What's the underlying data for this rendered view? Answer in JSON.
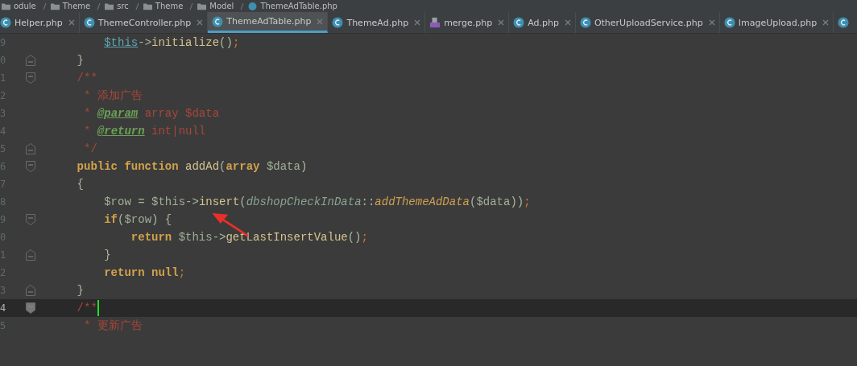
{
  "breadcrumb": [
    {
      "label": "odule",
      "kind": "folder"
    },
    {
      "label": "Theme",
      "kind": "folder"
    },
    {
      "label": "src",
      "kind": "folder"
    },
    {
      "label": "Theme",
      "kind": "folder"
    },
    {
      "label": "Model",
      "kind": "folder"
    },
    {
      "label": "ThemeAdTable.php",
      "kind": "class"
    }
  ],
  "tabs": [
    {
      "label": "Helper.php",
      "kind": "class",
      "selected": false
    },
    {
      "label": "ThemeController.php",
      "kind": "class",
      "selected": false
    },
    {
      "label": "ThemeAdTable.php",
      "kind": "class",
      "selected": true
    },
    {
      "label": "ThemeAd.php",
      "kind": "class",
      "selected": false
    },
    {
      "label": "merge.php",
      "kind": "php",
      "selected": false
    },
    {
      "label": "Ad.php",
      "kind": "class",
      "selected": false
    },
    {
      "label": "OtherUploadService.php",
      "kind": "class",
      "selected": false
    },
    {
      "label": "ImageUpload.php",
      "kind": "class",
      "selected": false
    },
    {
      "kind": "class",
      "selected": false
    }
  ],
  "lines": [
    {
      "number": "9",
      "current": false,
      "tokens": [
        {
          "text": "        $this",
          "kind": "thisref"
        },
        {
          "text": "->",
          "kind": "plain"
        },
        {
          "text": "initialize",
          "kind": "method"
        },
        {
          "text": "()",
          "kind": "plain"
        },
        {
          "text": ";",
          "kind": "punct"
        }
      ]
    },
    {
      "number": "0",
      "current": false,
      "fold": {
        "kind": "end"
      },
      "tokens": [
        {
          "text": "    }",
          "kind": "plain"
        }
      ]
    },
    {
      "number": "1",
      "current": false,
      "fold": {
        "kind": "start"
      },
      "tokens": [
        {
          "text": "    /**",
          "kind": "comment"
        }
      ]
    },
    {
      "number": "2",
      "current": false,
      "tokens": [
        {
          "text": "     * 添加广告",
          "kind": "comment"
        }
      ]
    },
    {
      "number": "3",
      "current": false,
      "tokens": [
        {
          "text": "     * ",
          "kind": "comment"
        },
        {
          "text": "@param",
          "kind": "doctag"
        },
        {
          "text": " array $data",
          "kind": "comment"
        }
      ]
    },
    {
      "number": "4",
      "current": false,
      "tokens": [
        {
          "text": "     * ",
          "kind": "comment"
        },
        {
          "text": "@return",
          "kind": "doctag"
        },
        {
          "text": " int|null",
          "kind": "comment"
        }
      ]
    },
    {
      "number": "5",
      "current": false,
      "fold": {
        "kind": "end"
      },
      "tokens": [
        {
          "text": "     */",
          "kind": "comment"
        }
      ]
    },
    {
      "number": "6",
      "current": false,
      "fold": {
        "kind": "start"
      },
      "tokens": [
        {
          "text": "    public function ",
          "kind": "kw"
        },
        {
          "text": "addAd",
          "kind": "method"
        },
        {
          "text": "(",
          "kind": "plain"
        },
        {
          "text": "array ",
          "kind": "kw"
        },
        {
          "text": "$data",
          "kind": "var"
        },
        {
          "text": ")",
          "kind": "plain"
        }
      ]
    },
    {
      "number": "7",
      "current": false,
      "tokens": [
        {
          "text": "    {",
          "kind": "plain"
        }
      ]
    },
    {
      "number": "8",
      "current": false,
      "tokens": [
        {
          "text": "        $row",
          "kind": "var"
        },
        {
          "text": " = ",
          "kind": "plain"
        },
        {
          "text": "$this",
          "kind": "var"
        },
        {
          "text": "->",
          "kind": "plain"
        },
        {
          "text": "insert",
          "kind": "method"
        },
        {
          "text": "(",
          "kind": "plain"
        },
        {
          "text": "dbshopCheckInData",
          "kind": "cls"
        },
        {
          "text": "::",
          "kind": "plain"
        },
        {
          "text": "addThemeAdData",
          "kind": "static"
        },
        {
          "text": "(",
          "kind": "plain"
        },
        {
          "text": "$data",
          "kind": "var"
        },
        {
          "text": "))",
          "kind": "plain"
        },
        {
          "text": ";",
          "kind": "punct"
        }
      ]
    },
    {
      "number": "9",
      "current": false,
      "fold": {
        "kind": "start"
      },
      "tokens": [
        {
          "text": "        if",
          "kind": "kw"
        },
        {
          "text": "(",
          "kind": "plain"
        },
        {
          "text": "$row",
          "kind": "var"
        },
        {
          "text": ") {",
          "kind": "plain"
        }
      ]
    },
    {
      "number": "0",
      "current": false,
      "tokens": [
        {
          "text": "            return ",
          "kind": "kw"
        },
        {
          "text": "$this",
          "kind": "var"
        },
        {
          "text": "->",
          "kind": "plain"
        },
        {
          "text": "getLastInsertValue",
          "kind": "method"
        },
        {
          "text": "()",
          "kind": "plain"
        },
        {
          "text": ";",
          "kind": "punct"
        }
      ]
    },
    {
      "number": "1",
      "current": false,
      "fold": {
        "kind": "end"
      },
      "tokens": [
        {
          "text": "        }",
          "kind": "plain"
        }
      ]
    },
    {
      "number": "2",
      "current": false,
      "tokens": [
        {
          "text": "        return null",
          "kind": "kw"
        },
        {
          "text": ";",
          "kind": "punct"
        }
      ]
    },
    {
      "number": "3",
      "current": false,
      "fold": {
        "kind": "end"
      },
      "tokens": [
        {
          "text": "    }",
          "kind": "plain"
        }
      ]
    },
    {
      "number": "4",
      "current": true,
      "fold": {
        "kind": "start"
      },
      "caret": true,
      "tokens": [
        {
          "text": "    /**",
          "kind": "comment"
        }
      ]
    },
    {
      "number": "5",
      "current": false,
      "tokens": [
        {
          "text": "     * 更新广告",
          "kind": "comment"
        }
      ]
    }
  ]
}
